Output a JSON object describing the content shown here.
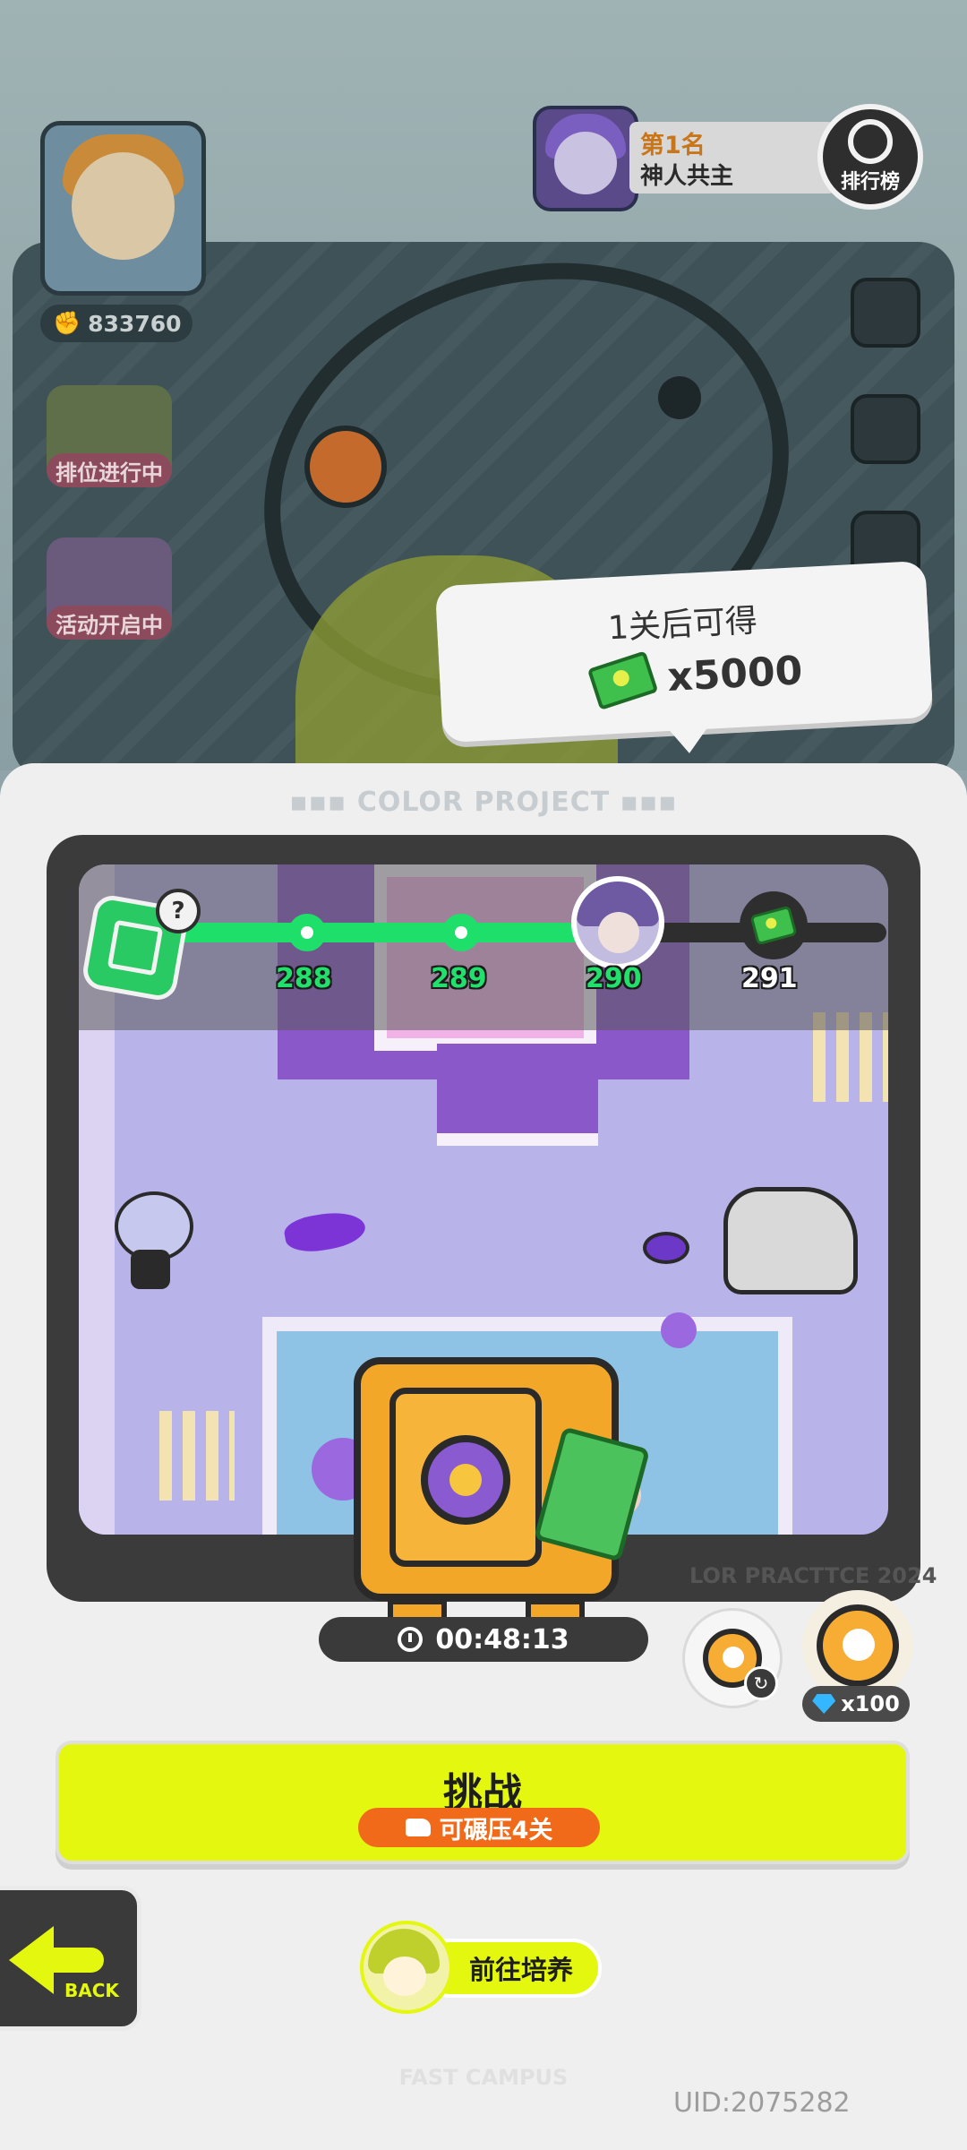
{
  "profile": {
    "power_value": "833760",
    "badges": [
      {
        "label": "排位进行中"
      },
      {
        "label": "活动开启中"
      }
    ]
  },
  "leaderboard": {
    "place": "第1名",
    "player_name": "神人共主",
    "button_label": "排行榜"
  },
  "reward_tooltip": {
    "title": "1关后可得",
    "amount": "x5000",
    "icon": "cash-icon"
  },
  "sheet": {
    "title": "COLOR PROJECT",
    "watermark": "LOR PRACTTCE 2024"
  },
  "progress": {
    "stages": [
      "288",
      "289",
      "290",
      "291"
    ],
    "current_stage": "290",
    "completed_fraction": 0.6
  },
  "timer": {
    "value": "00:48:13"
  },
  "boosts": {
    "gem_cost": "x100"
  },
  "challenge": {
    "label": "挑战",
    "sub_label": "可碾压4关"
  },
  "back": {
    "label": "BACK"
  },
  "train": {
    "label": "前往培养"
  },
  "footer": {
    "brand": "FAST CAMPUS",
    "uid": "UID:2075282"
  },
  "colors": {
    "accent_lime": "#e4f70e",
    "progress_green": "#1fdf6b",
    "sub_orange": "#f06a1a"
  }
}
